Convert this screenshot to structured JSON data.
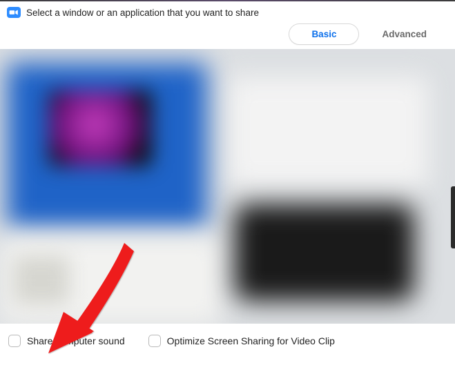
{
  "header": {
    "title": "Select a window or an application that you want to share"
  },
  "tabs": {
    "basic": "Basic",
    "advanced": "Advanced"
  },
  "footer": {
    "share_sound": "Share computer sound",
    "optimize_video": "Optimize Screen Sharing for Video Clip"
  }
}
